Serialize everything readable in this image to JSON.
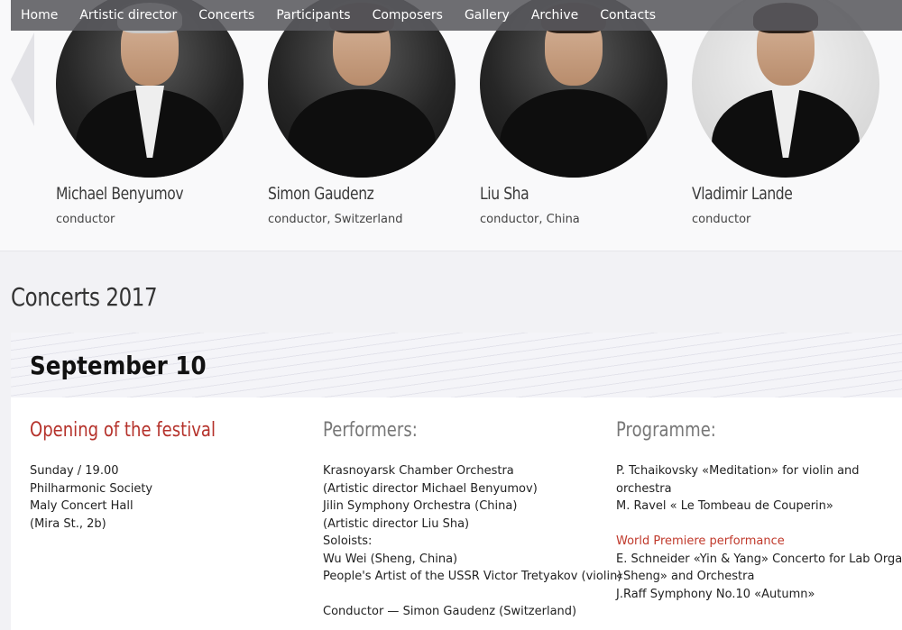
{
  "nav": {
    "items": [
      "Home",
      "Artistic director",
      "Concerts",
      "Participants",
      "Composers",
      "Gallery",
      "Archive",
      "Contacts"
    ]
  },
  "people": [
    {
      "name": "Michael Benyumov",
      "role": "conductor"
    },
    {
      "name": "Simon Gaudenz",
      "role": "conductor, Switzerland"
    },
    {
      "name": "Liu Sha",
      "role": "conductor, China"
    },
    {
      "name": "Vladimir Lande",
      "role": "conductor"
    }
  ],
  "concerts": {
    "title": "Concerts 2017",
    "date": "September 10",
    "event": {
      "title": "Opening of the festival",
      "lines": [
        "Sunday / 19.00",
        "Philharmonic Society",
        "Maly Concert Hall",
        "(Mira St., 2b)"
      ]
    },
    "performers": {
      "title": "Performers:",
      "lines": [
        "Krasnoyarsk Chamber Orchestra",
        "(Artistic director Michael Benyumov)",
        "Jilin Symphony Orchestra (China)",
        "(Artistic director Liu Sha)",
        "Soloists:",
        "Wu Wei (Sheng, China)",
        "People's Artist of the USSR Victor Tretyakov (violin)",
        "",
        "Conductor — Simon Gaudenz (Switzerland)"
      ]
    },
    "programme": {
      "title": "Programme:",
      "lines": [
        "P. Tchaikovsky «Meditation» for violin and",
        "orchestra",
        "M. Ravel « Le Tombeau de Couperin»",
        "",
        "World Premiere performance",
        "E. Schneider «Yin & Yang» Concerto for Lab Organ",
        "«Sheng» and Orchestra",
        "J.Raff Symphony No.10 «Autumn»"
      ]
    }
  },
  "colors": {
    "accent_red": "#b5322b",
    "nav_bg": "#5a5a5f"
  }
}
